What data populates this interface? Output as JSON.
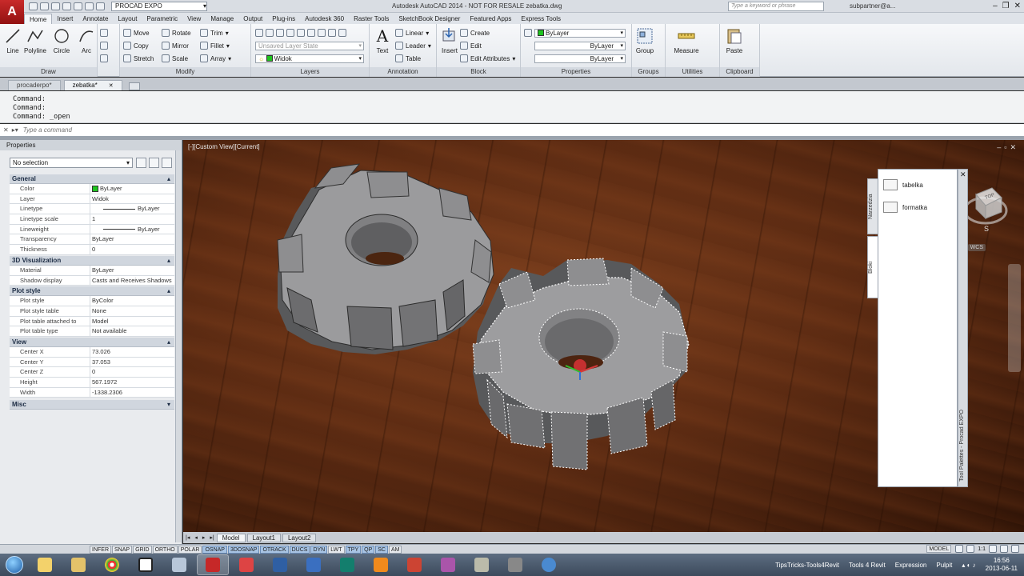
{
  "app": {
    "workspace": "PROCAD EXPO",
    "title": "Autodesk AutoCAD 2014 - NOT FOR RESALE    zebatka.dwg",
    "search_placeholder": "Type a keyword or phrase",
    "user": "subpartner@a...",
    "logo_letter": "A"
  },
  "ribbon_tabs": [
    "Home",
    "Insert",
    "Annotate",
    "Layout",
    "Parametric",
    "View",
    "Manage",
    "Output",
    "Plug-ins",
    "Autodesk 360",
    "Raster Tools",
    "SketchBook Designer",
    "Featured Apps",
    "Express Tools"
  ],
  "panels": {
    "draw": {
      "label": "Draw",
      "tools": [
        "Line",
        "Polyline",
        "Circle",
        "Arc"
      ]
    },
    "modify": {
      "label": "Modify",
      "rows": [
        [
          "Move",
          "Rotate",
          "Trim"
        ],
        [
          "Copy",
          "Mirror",
          "Fillet"
        ],
        [
          "Stretch",
          "Scale",
          "Array"
        ]
      ]
    },
    "layers": {
      "label": "Layers",
      "state": "Unsaved Layer State",
      "current": "Widok"
    },
    "annotation": {
      "label": "Annotation",
      "big": "Text",
      "tools": [
        "Linear",
        "Leader",
        "Table"
      ]
    },
    "block": {
      "label": "Block",
      "big": "Insert",
      "tools": [
        "Create",
        "Edit",
        "Edit Attributes"
      ]
    },
    "properties": {
      "label": "Properties",
      "color": "ByLayer",
      "linetype": "ByLayer",
      "lineweight": "ByLayer"
    },
    "groups": {
      "label": "Groups",
      "big": "Group"
    },
    "utilities": {
      "label": "Utilities",
      "big": "Measure"
    },
    "clipboard": {
      "label": "Clipboard",
      "big": "Paste"
    }
  },
  "file_tabs": [
    {
      "label": "procaderpo*",
      "active": false
    },
    {
      "label": "zebatka*",
      "active": true
    }
  ],
  "command": {
    "history": [
      "Command:",
      "Command:",
      "Command: _open"
    ],
    "placeholder": "Type a command"
  },
  "properties_palette": {
    "title": "Properties",
    "selection": "No selection",
    "sections": [
      {
        "name": "General",
        "rows": [
          {
            "k": "Color",
            "v": "ByLayer"
          },
          {
            "k": "Layer",
            "v": "Widok"
          },
          {
            "k": "Linetype",
            "v": "ByLayer"
          },
          {
            "k": "Linetype scale",
            "v": "1"
          },
          {
            "k": "Lineweight",
            "v": "ByLayer"
          },
          {
            "k": "Transparency",
            "v": "ByLayer"
          },
          {
            "k": "Thickness",
            "v": "0"
          }
        ]
      },
      {
        "name": "3D Visualization",
        "rows": [
          {
            "k": "Material",
            "v": "ByLayer"
          },
          {
            "k": "Shadow display",
            "v": "Casts and Receives Shadows"
          }
        ]
      },
      {
        "name": "Plot style",
        "rows": [
          {
            "k": "Plot style",
            "v": "ByColor"
          },
          {
            "k": "Plot style table",
            "v": "None"
          },
          {
            "k": "Plot table attached to",
            "v": "Model"
          },
          {
            "k": "Plot table type",
            "v": "Not available"
          }
        ]
      },
      {
        "name": "View",
        "rows": [
          {
            "k": "Center X",
            "v": "73.026"
          },
          {
            "k": "Center Y",
            "v": "37.053"
          },
          {
            "k": "Center Z",
            "v": "0"
          },
          {
            "k": "Height",
            "v": "567.1972"
          },
          {
            "k": "Width",
            "v": "-1338.2306"
          }
        ]
      }
    ],
    "misc": "Misc"
  },
  "viewport": {
    "label": "[-][Custom View][Current]",
    "wcs": "WCS",
    "viewcube_face": "TOP",
    "compass_s": "S"
  },
  "tool_palette": {
    "tabs": [
      "Narzedzia",
      "Bloki"
    ],
    "items": [
      "tabelka",
      "formatka"
    ],
    "title": "Tool Palettes - Procad EXPO"
  },
  "layout_tabs": [
    {
      "label": "Model",
      "active": true
    },
    {
      "label": "Layout1",
      "active": false
    },
    {
      "label": "Layout2",
      "active": false
    }
  ],
  "status": {
    "toggles": [
      {
        "t": "INFER",
        "on": false
      },
      {
        "t": "SNAP",
        "on": false
      },
      {
        "t": "GRID",
        "on": false
      },
      {
        "t": "ORTHO",
        "on": false
      },
      {
        "t": "POLAR",
        "on": false
      },
      {
        "t": "OSNAP",
        "on": true
      },
      {
        "t": "3DOSNAP",
        "on": true
      },
      {
        "t": "OTRACK",
        "on": true
      },
      {
        "t": "DUCS",
        "on": true
      },
      {
        "t": "DYN",
        "on": true
      },
      {
        "t": "LWT",
        "on": false
      },
      {
        "t": "TPY",
        "on": true
      },
      {
        "t": "QP",
        "on": true
      },
      {
        "t": "SC",
        "on": true
      },
      {
        "t": "AM",
        "on": false
      }
    ],
    "model": "MODEL",
    "scale": "1:1"
  },
  "taskbar": {
    "items": [
      "TipsTricks-Tools4Revit",
      "Tools 4 Revit",
      "Expression",
      "Pulpit"
    ],
    "time": "16:56",
    "date": "2013-06-11"
  },
  "colors": {
    "bylayer_swatch": "#1fc41f",
    "autocad_red": "#c62828",
    "gear_face": "#9a9a9a",
    "gear_side": "#6e6e70"
  }
}
